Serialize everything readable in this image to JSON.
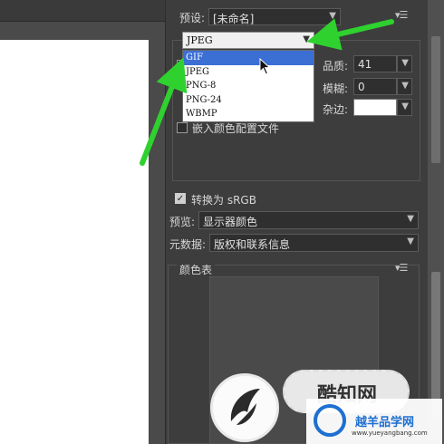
{
  "preset": {
    "label": "预设:",
    "value": "[未命名]"
  },
  "format": {
    "current": "JPEG",
    "options": [
      "GIF",
      "JPEG",
      "PNG-8",
      "PNG-24",
      "WBMP"
    ],
    "highlighted": "GIF"
  },
  "settings": {
    "quality_label": "品质:",
    "quality_value": "41",
    "blur_label": "模糊:",
    "blur_value": "0",
    "matte_label": "杂边:",
    "embed_profile_label": "嵌入颜色配置文件"
  },
  "convert": {
    "label": "转换为 sRGB",
    "checked": true
  },
  "preview": {
    "label": "预览:",
    "value": "显示器颜色"
  },
  "metadata": {
    "label": "元数据:",
    "value": "版权和联系信息"
  },
  "color_table": {
    "label": "颜色表"
  },
  "watermark": {
    "brand": "酷知网",
    "logo_name": "越羊品学网",
    "logo_url": "www.yueyangbang.com"
  },
  "colors": {
    "panel": "#3d3d3d",
    "arrow": "#2fd12f",
    "selection": "#3b6fd4"
  }
}
